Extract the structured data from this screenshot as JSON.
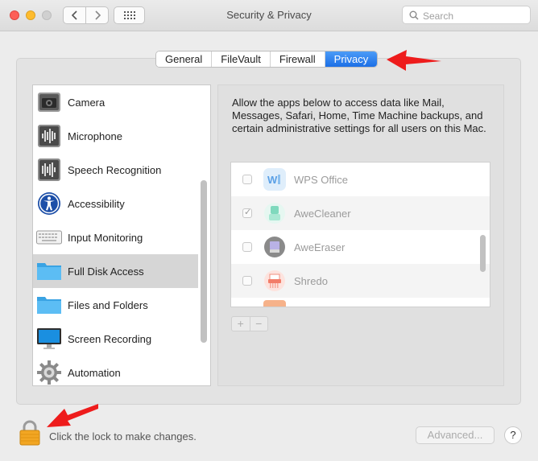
{
  "window": {
    "title": "Security & Privacy"
  },
  "search": {
    "placeholder": "Search"
  },
  "tabs": [
    {
      "label": "General",
      "active": false
    },
    {
      "label": "FileVault",
      "active": false
    },
    {
      "label": "Firewall",
      "active": false
    },
    {
      "label": "Privacy",
      "active": true
    }
  ],
  "sidebar": {
    "items": [
      {
        "label": "Camera",
        "icon": "camera-icon"
      },
      {
        "label": "Microphone",
        "icon": "microphone-icon"
      },
      {
        "label": "Speech Recognition",
        "icon": "speech-recognition-icon"
      },
      {
        "label": "Accessibility",
        "icon": "accessibility-icon"
      },
      {
        "label": "Input Monitoring",
        "icon": "keyboard-icon"
      },
      {
        "label": "Full Disk Access",
        "icon": "folder-icon",
        "selected": true
      },
      {
        "label": "Files and Folders",
        "icon": "folder-icon"
      },
      {
        "label": "Screen Recording",
        "icon": "display-icon"
      },
      {
        "label": "Automation",
        "icon": "gear-icon"
      }
    ]
  },
  "main": {
    "description": "Allow the apps below to access data like Mail, Messages, Safari, Home, Time Machine backups, and certain administrative settings for all users on this Mac.",
    "apps": [
      {
        "name": "WPS Office",
        "checked": false,
        "icon": "wps-office-icon"
      },
      {
        "name": "AweCleaner",
        "checked": true,
        "icon": "awecleaner-icon"
      },
      {
        "name": "AweEraser",
        "checked": false,
        "icon": "aweeraser-icon"
      },
      {
        "name": "Shredo",
        "checked": false,
        "icon": "shredo-icon"
      }
    ],
    "add_label": "+",
    "remove_label": "−"
  },
  "footer": {
    "lock_text": "Click the lock to make changes.",
    "advanced_label": "Advanced...",
    "help_label": "?"
  },
  "colors": {
    "accent": "#1c6fe6",
    "annotation_arrow": "#ee1c1c",
    "lock": "#f2a623"
  }
}
